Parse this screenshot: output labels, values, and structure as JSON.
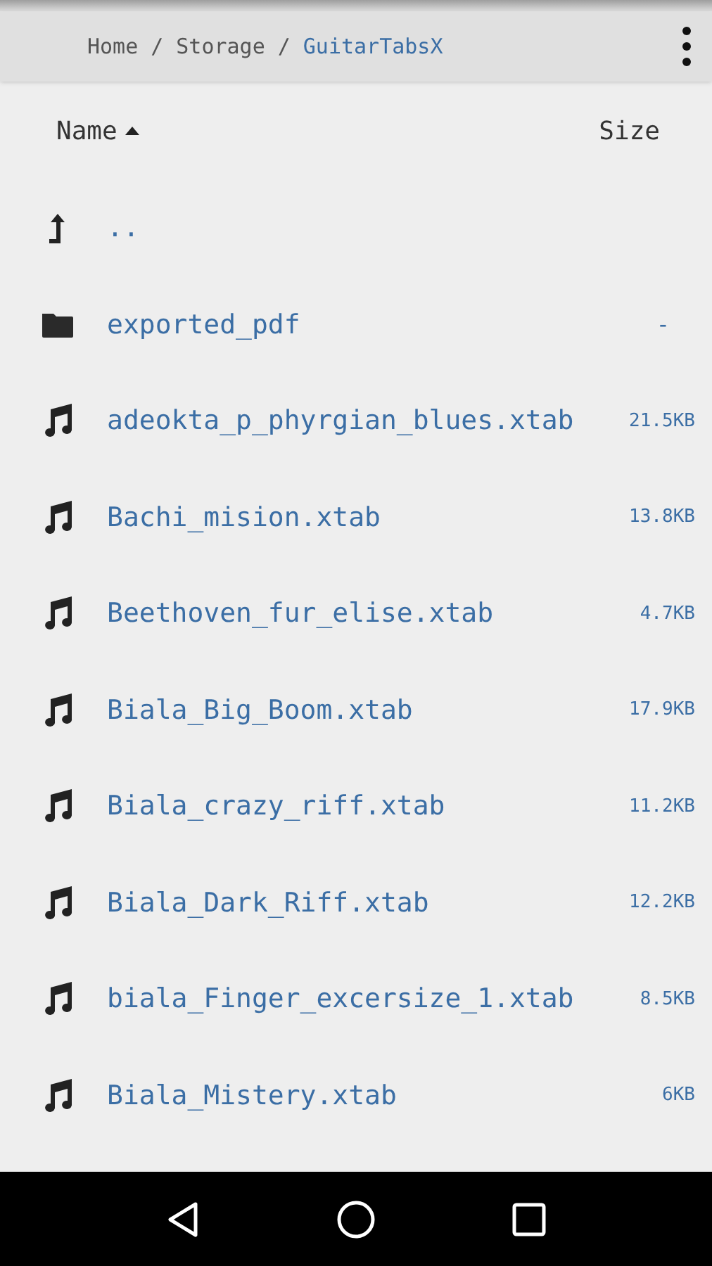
{
  "breadcrumb": [
    {
      "label": "Home",
      "current": false
    },
    {
      "label": "Storage",
      "current": false
    },
    {
      "label": "GuitarTabsX",
      "current": true
    }
  ],
  "separator": "/",
  "columns": {
    "name": "Name",
    "size": "Size"
  },
  "items": [
    {
      "kind": "parent",
      "name": ".."
    },
    {
      "kind": "folder",
      "name": "exported_pdf",
      "size": "-"
    },
    {
      "kind": "file",
      "name": "adeokta_p_phyrgian_blues.xtab",
      "size": "21.5KB"
    },
    {
      "kind": "file",
      "name": "Bachi_mision.xtab",
      "size": "13.8KB"
    },
    {
      "kind": "file",
      "name": "Beethoven_fur_elise.xtab",
      "size": "4.7KB"
    },
    {
      "kind": "file",
      "name": "Biala_Big_Boom.xtab",
      "size": "17.9KB"
    },
    {
      "kind": "file",
      "name": "Biala_crazy_riff.xtab",
      "size": "11.2KB"
    },
    {
      "kind": "file",
      "name": "Biala_Dark_Riff.xtab",
      "size": "12.2KB"
    },
    {
      "kind": "file",
      "name": "biala_Finger_excersize_1.xtab",
      "size": "8.5KB"
    },
    {
      "kind": "file",
      "name": "Biala_Mistery.xtab",
      "size": "6KB"
    }
  ]
}
